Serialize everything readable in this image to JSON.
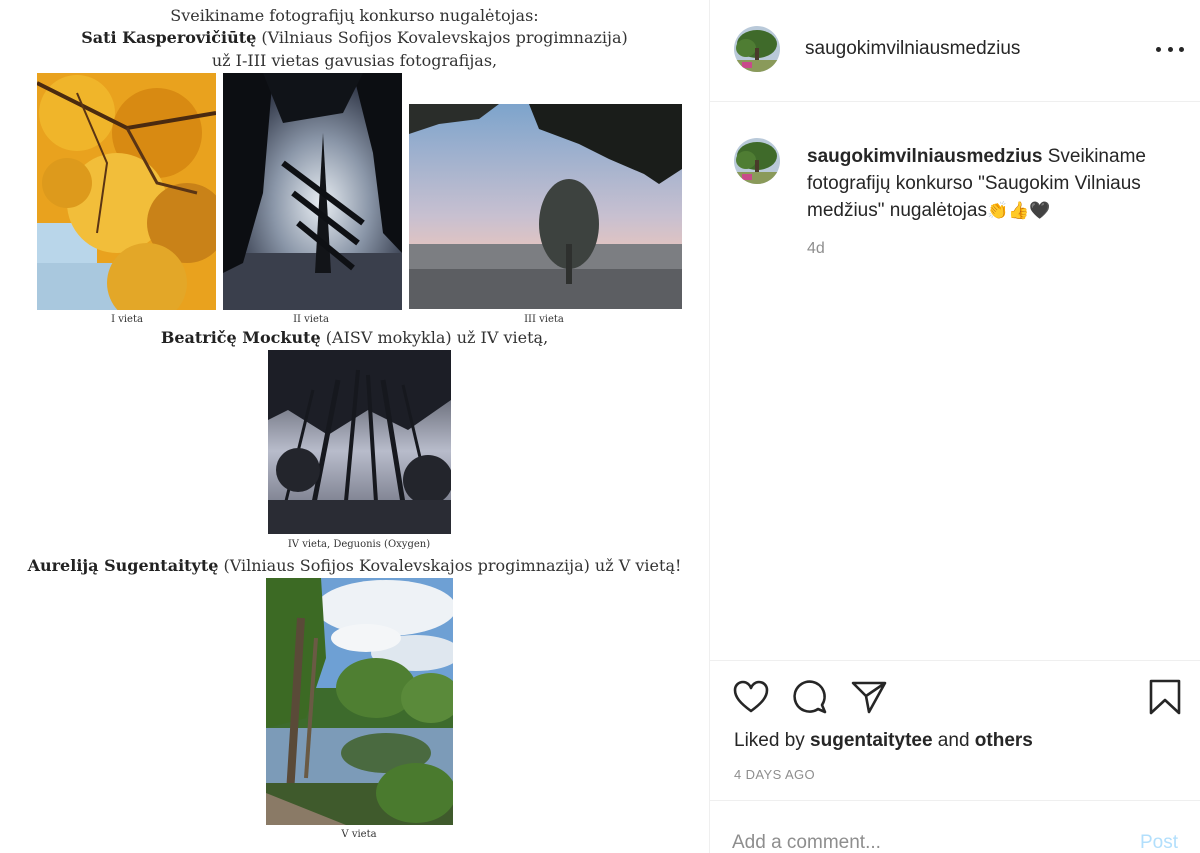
{
  "post_image": {
    "line1": "Sveikiname fotografijų konkurso nugalėtojas:",
    "line2_bold": "Sati Kasperovičiūtę",
    "line2_rest": " (Vilniaus Sofijos Kovalevskajos progimnazija)",
    "line3": "už I-III vietas gavusias fotografijas,",
    "caption_1": "I vieta",
    "caption_2": "II vieta",
    "caption_3": "III vieta",
    "line4_bold": "Beatričę Mockutę",
    "line4_rest": " (AISV mokykla) už IV vietą,",
    "caption_4": "IV vieta, Deguonis (Oxygen)",
    "line5_bold": "Aureliją Sugentaitytę",
    "line5_rest": " (Vilniaus Sofijos Kovalevskajos progimnazija) už V vietą!",
    "caption_5": "V vieta"
  },
  "header": {
    "username": "saugokimvilniausmedzius",
    "more_icon": "more-horizontal-icon"
  },
  "caption": {
    "username": "saugokimvilniausmedzius",
    "text": " Sveikiname fotografijų konkurso \"Saugokim Vilniaus medžius\" nugalėtojas",
    "emojis": "👏👍🖤",
    "time": "4d"
  },
  "actions": {
    "like_icon": "heart-icon",
    "comment_icon": "comment-bubble-icon",
    "share_icon": "paper-plane-icon",
    "save_icon": "bookmark-icon"
  },
  "likes": {
    "prefix": "Liked by ",
    "user": "sugentaitytee",
    "middle": " and ",
    "others": "others"
  },
  "timestamp": "4 DAYS AGO",
  "comment": {
    "placeholder": "Add a comment...",
    "post_label": "Post"
  },
  "colors": {
    "text": "#262626",
    "muted": "#8e8e8e",
    "border": "#efefef",
    "post_disabled": "#b2dffc"
  }
}
